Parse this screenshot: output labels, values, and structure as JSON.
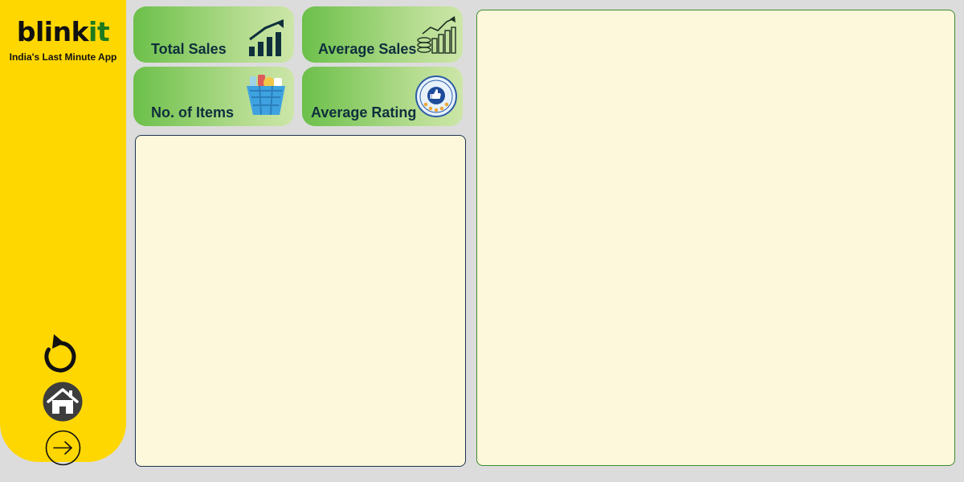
{
  "brand": {
    "name_part1": "blink",
    "name_part2": "it",
    "tagline": "India's Last Minute App"
  },
  "sidebar": {
    "icons": [
      "refresh-icon",
      "home-icon",
      "arrow-right-icon"
    ]
  },
  "kpis": [
    {
      "label": "Total Sales",
      "icon": "growth-chart-icon"
    },
    {
      "label": "Average Sales",
      "icon": "coins-chart-icon"
    },
    {
      "label": "No. of Items",
      "icon": "grocery-basket-icon"
    },
    {
      "label": "Average Rating",
      "icon": "recommend-badge-icon",
      "badge_text": "RECOMMEND"
    }
  ],
  "colors": {
    "sidebar": "#ffd700",
    "brand_accent": "#1d7a1f",
    "card_start": "#6cc04a",
    "card_end": "#cce6a8",
    "panel_bg": "#fdf8db",
    "page_bg": "#dcdcdc"
  }
}
